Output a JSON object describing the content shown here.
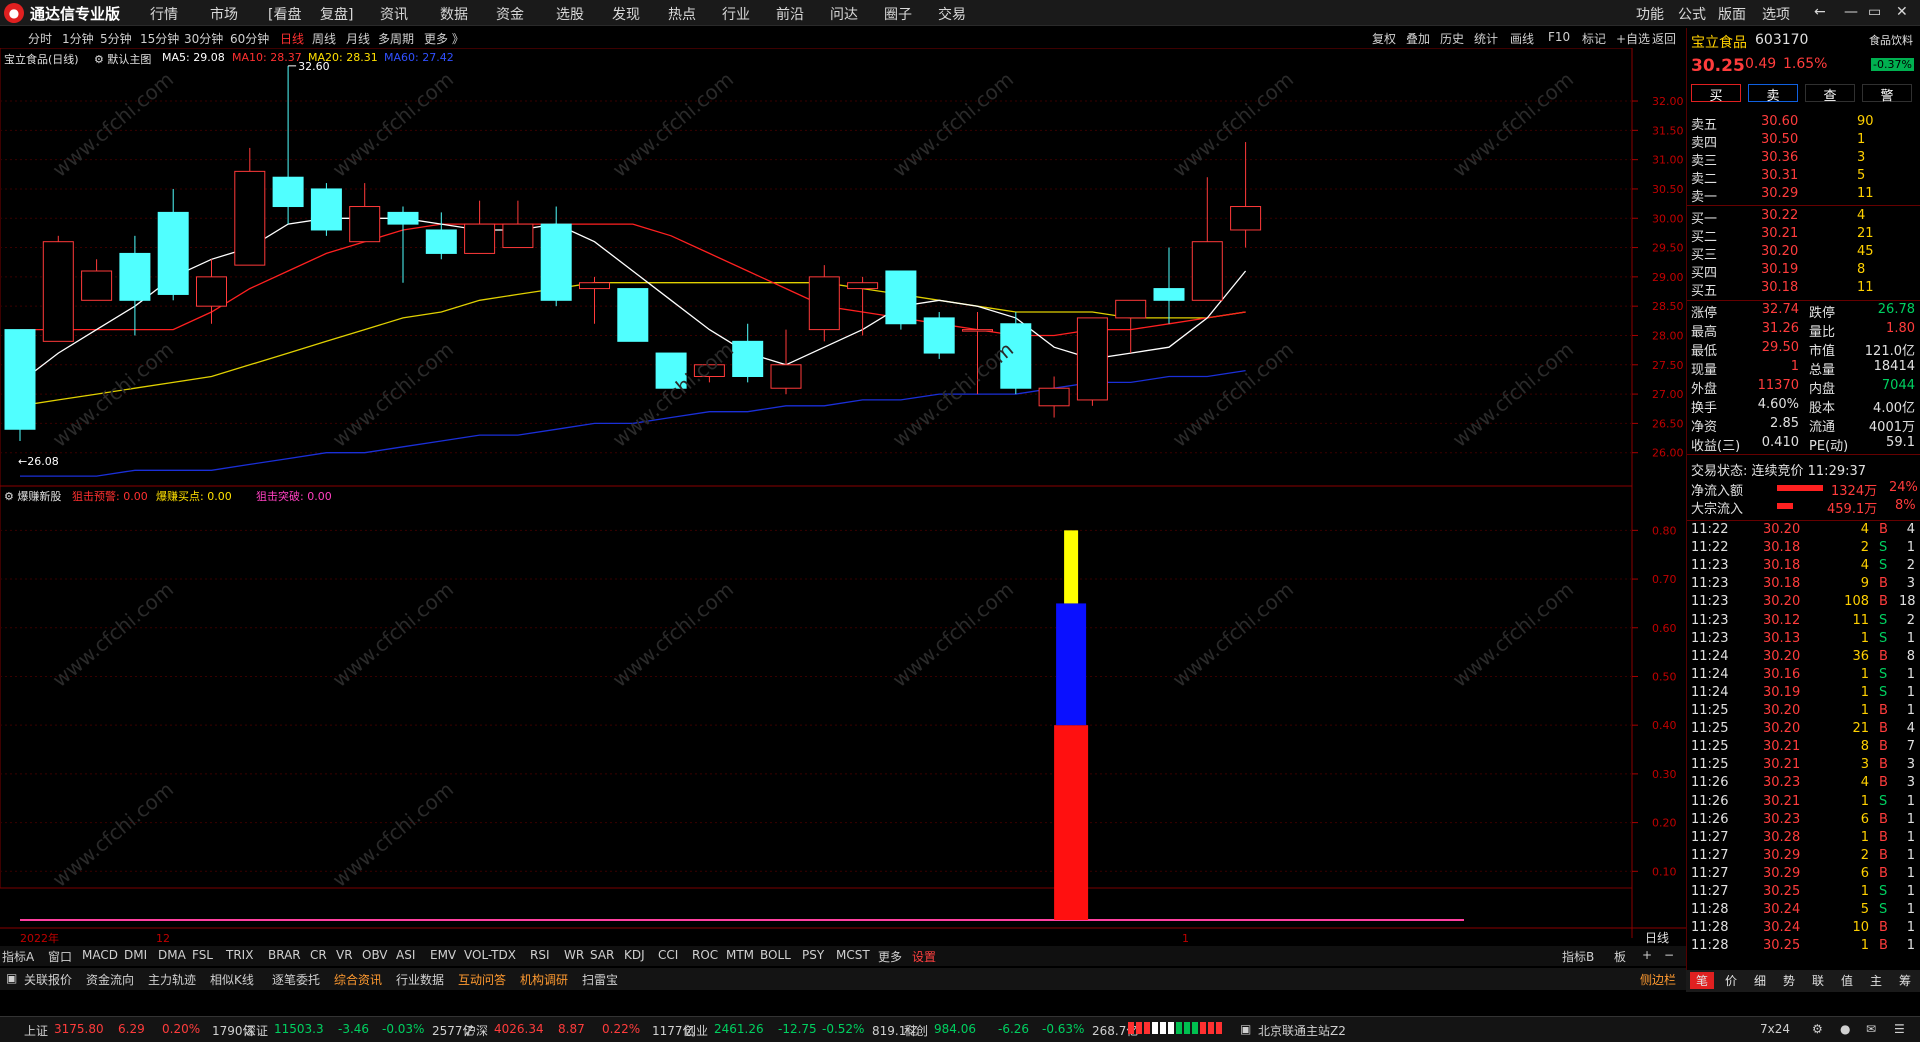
{
  "app": {
    "title": "通达信专业版"
  },
  "menu": [
    "行情",
    "市场",
    "[看盘",
    "复盘]",
    "资讯",
    "数据",
    "资金",
    "选股",
    "发现",
    "热点",
    "行业",
    "前沿",
    "问达",
    "圈子",
    "交易"
  ],
  "right_menu": [
    "功能",
    "公式",
    "版面",
    "选项"
  ],
  "periods": [
    "分时",
    "1分钟",
    "5分钟",
    "15分钟",
    "30分钟",
    "60分钟",
    "日线",
    "周线",
    "月线",
    "多周期",
    "更多 》"
  ],
  "active_period": "日线",
  "toolbar": [
    "复权",
    "叠加",
    "历史",
    "统计",
    "画线",
    "F10",
    "标记",
    "+自选",
    "返回"
  ],
  "chart": {
    "stock_label": "宝立食品(日线)",
    "main_label": "默认主图",
    "ma5": "MA5: 29.08",
    "ma10": "MA10: 28.37",
    "ma20": "MA20: 28.31",
    "ma60": "MA60: 27.42",
    "high_mark": "32.60",
    "low_mark": "26.08",
    "yaxis_top": [
      "32.00",
      "31.50",
      "31.00",
      "30.50",
      "30.00",
      "29.50",
      "29.00",
      "28.50",
      "28.00",
      "27.50",
      "27.00",
      "26.50",
      "26.00"
    ],
    "indicator_name": "爆赚新股",
    "ind_a": "狙击预警: 0.00",
    "ind_b": "爆赚买点: 0.00",
    "ind_c": "狙击突破: 0.00",
    "yaxis_bottom": [
      "0.80",
      "0.70",
      "0.60",
      "0.50",
      "0.40",
      "0.30",
      "0.20",
      "0.10"
    ],
    "xaxis": [
      "2022年",
      "12",
      "1"
    ],
    "xaxis_right": "日线"
  },
  "chart_data": {
    "type": "candlestick",
    "ylim": [
      25.5,
      32.7
    ],
    "candles": [
      {
        "o": 26.4,
        "h": 28.1,
        "l": 26.2,
        "c": 28.1,
        "up": false
      },
      {
        "o": 27.9,
        "h": 29.7,
        "l": 27.9,
        "c": 29.6,
        "up": true
      },
      {
        "o": 28.6,
        "h": 29.3,
        "l": 28.6,
        "c": 29.1,
        "up": true
      },
      {
        "o": 28.6,
        "h": 29.7,
        "l": 28.0,
        "c": 29.4,
        "up": false
      },
      {
        "o": 28.7,
        "h": 30.5,
        "l": 28.6,
        "c": 30.1,
        "up": false
      },
      {
        "o": 28.5,
        "h": 29.3,
        "l": 28.2,
        "c": 29.0,
        "up": true
      },
      {
        "o": 29.2,
        "h": 31.2,
        "l": 29.2,
        "c": 30.8,
        "up": true
      },
      {
        "o": 30.2,
        "h": 32.6,
        "l": 29.9,
        "c": 30.7,
        "up": false
      },
      {
        "o": 30.5,
        "h": 30.6,
        "l": 29.7,
        "c": 29.8,
        "up": false
      },
      {
        "o": 29.6,
        "h": 30.6,
        "l": 29.6,
        "c": 30.2,
        "up": true
      },
      {
        "o": 30.1,
        "h": 30.2,
        "l": 28.9,
        "c": 29.9,
        "up": false
      },
      {
        "o": 29.8,
        "h": 30.1,
        "l": 29.3,
        "c": 29.4,
        "up": false
      },
      {
        "o": 29.4,
        "h": 30.3,
        "l": 29.4,
        "c": 29.9,
        "up": true
      },
      {
        "o": 29.5,
        "h": 30.3,
        "l": 29.5,
        "c": 29.9,
        "up": true
      },
      {
        "o": 29.9,
        "h": 30.2,
        "l": 28.5,
        "c": 28.6,
        "up": false
      },
      {
        "o": 28.9,
        "h": 29.0,
        "l": 28.2,
        "c": 28.8,
        "up": true
      },
      {
        "o": 28.8,
        "h": 28.8,
        "l": 27.9,
        "c": 27.9,
        "up": false
      },
      {
        "o": 27.7,
        "h": 27.7,
        "l": 27.1,
        "c": 27.1,
        "up": false
      },
      {
        "o": 27.3,
        "h": 27.5,
        "l": 27.2,
        "c": 27.5,
        "up": true
      },
      {
        "o": 27.9,
        "h": 28.2,
        "l": 27.2,
        "c": 27.3,
        "up": false
      },
      {
        "o": 27.1,
        "h": 28.1,
        "l": 27.0,
        "c": 27.5,
        "up": true
      },
      {
        "o": 28.1,
        "h": 29.2,
        "l": 27.9,
        "c": 29.0,
        "up": true
      },
      {
        "o": 28.8,
        "h": 29.0,
        "l": 28.0,
        "c": 28.9,
        "up": true
      },
      {
        "o": 29.1,
        "h": 29.1,
        "l": 28.1,
        "c": 28.2,
        "up": false
      },
      {
        "o": 28.3,
        "h": 28.4,
        "l": 27.6,
        "c": 27.7,
        "up": false
      },
      {
        "o": 28.1,
        "h": 28.4,
        "l": 27.0,
        "c": 28.1,
        "up": true
      },
      {
        "o": 28.2,
        "h": 28.4,
        "l": 27.0,
        "c": 27.1,
        "up": false
      },
      {
        "o": 26.8,
        "h": 27.3,
        "l": 26.6,
        "c": 27.1,
        "up": true
      },
      {
        "o": 26.9,
        "h": 28.3,
        "l": 26.8,
        "c": 28.3,
        "up": true
      },
      {
        "o": 28.3,
        "h": 28.6,
        "l": 27.7,
        "c": 28.6,
        "up": true
      },
      {
        "o": 28.8,
        "h": 29.5,
        "l": 28.2,
        "c": 28.6,
        "up": false
      },
      {
        "o": 28.6,
        "h": 30.7,
        "l": 28.6,
        "c": 29.6,
        "up": true
      },
      {
        "o": 29.8,
        "h": 31.3,
        "l": 29.5,
        "c": 30.2,
        "up": true
      }
    ],
    "ma5": [
      27.2,
      27.7,
      28.1,
      28.5,
      29.0,
      29.3,
      29.5,
      29.9,
      30.0,
      30.0,
      30.0,
      29.9,
      29.8,
      29.8,
      29.9,
      29.6,
      29.1,
      28.6,
      28.1,
      27.7,
      27.5,
      27.8,
      28.1,
      28.5,
      28.6,
      28.5,
      28.3,
      27.8,
      27.6,
      27.7,
      27.8,
      28.3,
      29.1
    ],
    "ma10": [
      28.1,
      28.1,
      28.1,
      28.1,
      28.1,
      28.4,
      28.8,
      29.1,
      29.4,
      29.6,
      29.8,
      29.9,
      29.9,
      29.9,
      29.9,
      29.9,
      29.9,
      29.7,
      29.4,
      29.1,
      28.8,
      28.5,
      28.4,
      28.3,
      28.2,
      28.1,
      28.0,
      28.0,
      28.1,
      28.1,
      28.2,
      28.3,
      28.4
    ],
    "ma20": [
      26.8,
      26.9,
      27.0,
      27.1,
      27.2,
      27.3,
      27.5,
      27.7,
      27.9,
      28.1,
      28.3,
      28.4,
      28.6,
      28.7,
      28.8,
      28.9,
      28.9,
      28.9,
      28.9,
      28.9,
      28.9,
      28.9,
      28.8,
      28.7,
      28.6,
      28.5,
      28.4,
      28.4,
      28.4,
      28.3,
      28.3,
      28.3,
      28.4
    ],
    "ma60": [
      25.6,
      25.6,
      25.6,
      25.7,
      25.7,
      25.7,
      25.8,
      25.9,
      26.0,
      26.0,
      26.1,
      26.2,
      26.3,
      26.3,
      26.4,
      26.5,
      26.5,
      26.6,
      26.7,
      26.7,
      26.8,
      26.8,
      26.9,
      26.9,
      27.0,
      27.0,
      27.0,
      27.1,
      27.2,
      27.2,
      27.3,
      27.3,
      27.4
    ],
    "indicator": {
      "index": 27,
      "red": 0.4,
      "blue": 0.65,
      "yellow": 0.8,
      "ylim": [
        0,
        0.85
      ]
    }
  },
  "quote": {
    "name": "宝立食品",
    "code": "603170",
    "sector": "食品饮料",
    "sector_chg": "-0.37%",
    "price": "30.25",
    "change": "0.49",
    "pct": "1.65%",
    "buttons": [
      "买",
      "卖",
      "查",
      "警"
    ],
    "asks": [
      [
        "卖五",
        "30.60",
        "90"
      ],
      [
        "卖四",
        "30.50",
        "1"
      ],
      [
        "卖三",
        "30.36",
        "3"
      ],
      [
        "卖二",
        "30.31",
        "5"
      ],
      [
        "卖一",
        "30.29",
        "11"
      ]
    ],
    "bids": [
      [
        "买一",
        "30.22",
        "4"
      ],
      [
        "买二",
        "30.21",
        "21"
      ],
      [
        "买三",
        "30.20",
        "45"
      ],
      [
        "买四",
        "30.19",
        "8"
      ],
      [
        "买五",
        "30.18",
        "11"
      ]
    ],
    "stats": [
      [
        "涨停",
        "32.74",
        "跌停",
        "26.78"
      ],
      [
        "最高",
        "31.26",
        "量比",
        "1.80"
      ],
      [
        "最低",
        "29.50",
        "市值",
        "121.0亿"
      ],
      [
        "现量",
        "1",
        "总量",
        "18414"
      ],
      [
        "外盘",
        "11370",
        "内盘",
        "7044"
      ],
      [
        "换手",
        "4.60%",
        "股本",
        "4.00亿"
      ],
      [
        "净资",
        "2.85",
        "流通",
        "4001万"
      ],
      [
        "收益(三)",
        "0.410",
        "PE(动)",
        "59.1"
      ]
    ],
    "trade_status": "交易状态: 连续竞价 11:29:37",
    "net_inflow_label": "净流入额",
    "net_inflow": "1324万",
    "net_inflow_pct": "24%",
    "big_inflow_label": "大宗流入",
    "big_inflow": "459.1万",
    "big_inflow_pct": "8%",
    "ticks": [
      [
        "11:22",
        "30.20",
        "4",
        "B",
        "4"
      ],
      [
        "11:22",
        "30.18",
        "2",
        "S",
        "1"
      ],
      [
        "11:23",
        "30.18",
        "4",
        "S",
        "2"
      ],
      [
        "11:23",
        "30.18",
        "9",
        "B",
        "3"
      ],
      [
        "11:23",
        "30.20",
        "108",
        "B",
        "18"
      ],
      [
        "11:23",
        "30.12",
        "11",
        "S",
        "2"
      ],
      [
        "11:23",
        "30.13",
        "1",
        "S",
        "1"
      ],
      [
        "11:24",
        "30.20",
        "36",
        "B",
        "8"
      ],
      [
        "11:24",
        "30.16",
        "1",
        "S",
        "1"
      ],
      [
        "11:24",
        "30.19",
        "1",
        "S",
        "1"
      ],
      [
        "11:25",
        "30.20",
        "1",
        "B",
        "1"
      ],
      [
        "11:25",
        "30.20",
        "21",
        "B",
        "4"
      ],
      [
        "11:25",
        "30.21",
        "8",
        "B",
        "7"
      ],
      [
        "11:25",
        "30.21",
        "3",
        "B",
        "3"
      ],
      [
        "11:26",
        "30.23",
        "4",
        "B",
        "3"
      ],
      [
        "11:26",
        "30.21",
        "1",
        "S",
        "1"
      ],
      [
        "11:26",
        "30.23",
        "6",
        "B",
        "1"
      ],
      [
        "11:27",
        "30.28",
        "1",
        "B",
        "1"
      ],
      [
        "11:27",
        "30.29",
        "2",
        "B",
        "1"
      ],
      [
        "11:27",
        "30.29",
        "6",
        "B",
        "1"
      ],
      [
        "11:27",
        "30.25",
        "1",
        "S",
        "1"
      ],
      [
        "11:28",
        "30.24",
        "5",
        "S",
        "1"
      ],
      [
        "11:28",
        "30.24",
        "10",
        "B",
        "1"
      ],
      [
        "11:28",
        "30.25",
        "1",
        "B",
        "1"
      ]
    ],
    "bottom_tabs": [
      "笔",
      "价",
      "细",
      "势",
      "联",
      "值",
      "主",
      "筹"
    ]
  },
  "tabs_row1": [
    "指标A",
    "窗口",
    "MACD",
    "DMI",
    "DMA",
    "FSL",
    "TRIX",
    "BRAR",
    "CR",
    "VR",
    "OBV",
    "ASI",
    "EMV",
    "VOL-TDX",
    "RSI",
    "WR",
    "SAR",
    "KDJ",
    "CCI",
    "ROC",
    "MTM",
    "BOLL",
    "PSY",
    "MCST",
    "更多",
    "设置"
  ],
  "tabs_row1_right": [
    "指标B",
    "板"
  ],
  "tabs_row2": [
    "关联报价",
    "资金流向",
    "主力轨迹",
    "相似K线",
    "逐笔委托",
    "综合资讯",
    "行业数据",
    "互动问答",
    "机构调研",
    "扫雷宝"
  ],
  "tabs_row2_right": "侧边栏",
  "status": {
    "sh": [
      "上证",
      "3175.80",
      "6.29",
      "0.20%",
      "1790亿"
    ],
    "sz": [
      "深证",
      "11503.3",
      "-3.46",
      "-0.03%",
      "2577亿"
    ],
    "hs": [
      "沪深",
      "4026.34",
      "8.87",
      "0.22%",
      "1177亿"
    ],
    "cy": [
      "创业",
      "2461.26",
      "-12.75",
      "-0.52%",
      "819.1亿"
    ],
    "kc": [
      "科创",
      "984.06",
      "-6.26",
      "-0.63%",
      "268.7亿"
    ],
    "server": "北京联通主站Z2",
    "mode": "7x24"
  },
  "watermark": "www.cfchi.com"
}
